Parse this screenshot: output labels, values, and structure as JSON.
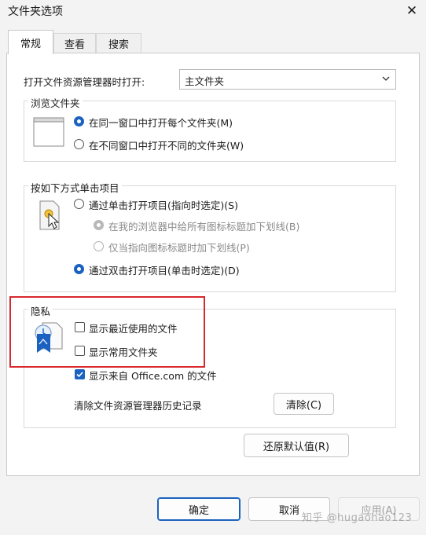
{
  "window": {
    "title": "文件夹选项",
    "close_glyph": "✕"
  },
  "tabs": [
    {
      "label": "常规",
      "active": true
    },
    {
      "label": "查看",
      "active": false
    },
    {
      "label": "搜索",
      "active": false
    }
  ],
  "open_explorer": {
    "label": "打开文件资源管理器时打开:",
    "value": "主文件夹"
  },
  "browse": {
    "title": "浏览文件夹",
    "options": [
      {
        "label": "在同一窗口中打开每个文件夹(M)",
        "selected": true
      },
      {
        "label": "在不同窗口中打开不同的文件夹(W)",
        "selected": false
      }
    ]
  },
  "click": {
    "title": "按如下方式单击项目",
    "single": "通过单击打开项目(指向时选定)(S)",
    "sub1": "在我的浏览器中给所有图标标题加下划线(B)",
    "sub2": "仅当指向图标标题时加下划线(P)",
    "double": "通过双击打开项目(单击时选定)(D)"
  },
  "privacy": {
    "title": "隐私",
    "recent": "显示最近使用的文件",
    "frequent": "显示常用文件夹",
    "office": "显示来自 Office.com 的文件",
    "clear_label": "清除文件资源管理器历史记录",
    "clear_button": "清除(C)"
  },
  "restore_button": "还原默认值(R)",
  "footer": {
    "ok": "确定",
    "cancel": "取消",
    "apply": "应用(A)"
  },
  "watermark": "知乎 @hugaohao123",
  "colors": {
    "accent": "#1b62c0",
    "highlight_box": "#d8272d"
  }
}
